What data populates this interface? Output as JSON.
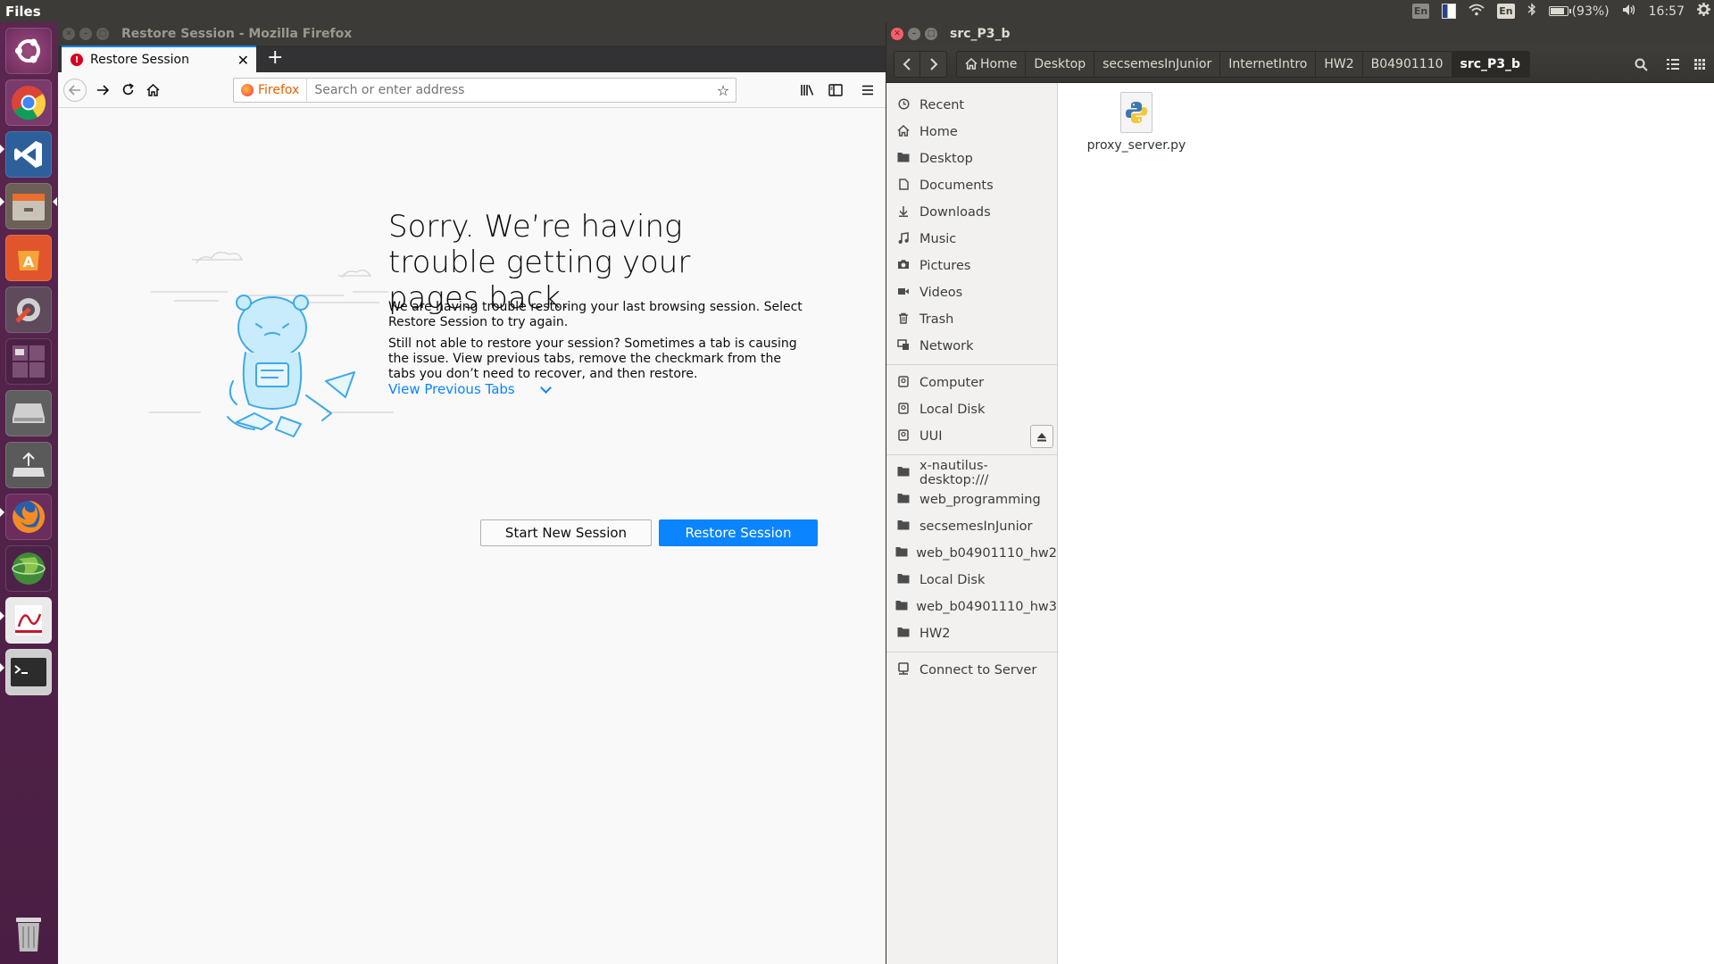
{
  "top_panel": {
    "app_name": "Files",
    "keyboard_indicator_1": "En",
    "keyboard_indicator_2": "En",
    "battery_percent_text": "(93%)",
    "battery_level": 0.93,
    "clock": "16:57"
  },
  "firefox": {
    "window_title": "Restore Session - Mozilla Firefox",
    "tab_title": "Restore Session",
    "identity_label": "Firefox",
    "url_placeholder": "Search or enter address",
    "error_title": "Sorry. We’re having trouble getting your pages back.",
    "paragraph_1": "We are having trouble restoring your last browsing session. Select Restore Session to try again.",
    "paragraph_2": "Still not able to restore your session? Sometimes a tab is causing the issue. View previous tabs, remove the checkmark from the tabs you don’t need to recover, and then restore.",
    "view_previous_tabs": "View Previous Tabs",
    "start_new_session": "Start New Session",
    "restore_session": "Restore Session"
  },
  "nautilus": {
    "window_title": "src_P3_b",
    "breadcrumbs": [
      "Home",
      "Desktop",
      "secsemesInJunior",
      "InternetIntro",
      "HW2",
      "B04901110",
      "src_P3_b"
    ],
    "places": [
      {
        "label": "Recent",
        "icon": "clock-icon"
      },
      {
        "label": "Home",
        "icon": "home-icon"
      },
      {
        "label": "Desktop",
        "icon": "folder-icon"
      },
      {
        "label": "Documents",
        "icon": "document-icon"
      },
      {
        "label": "Downloads",
        "icon": "download-icon"
      },
      {
        "label": "Music",
        "icon": "music-icon"
      },
      {
        "label": "Pictures",
        "icon": "camera-icon"
      },
      {
        "label": "Videos",
        "icon": "video-icon"
      },
      {
        "label": "Trash",
        "icon": "trash-icon"
      },
      {
        "label": "Network",
        "icon": "network-icon"
      }
    ],
    "devices": [
      {
        "label": "Computer"
      },
      {
        "label": "Local Disk"
      },
      {
        "label": "UUI"
      }
    ],
    "bookmarks": [
      {
        "label": "x-nautilus-desktop:///"
      },
      {
        "label": "web_programming"
      },
      {
        "label": "secsemesInJunior"
      },
      {
        "label": "web_b04901110_hw2"
      },
      {
        "label": "Local Disk"
      },
      {
        "label": "web_b04901110_hw3"
      },
      {
        "label": "HW2"
      }
    ],
    "connect_to_server": "Connect to Server",
    "files": [
      {
        "name": "proxy_server.py",
        "icon": "python-file-icon"
      }
    ]
  },
  "launcher": [
    "ubuntu-logo-icon",
    "chrome-icon",
    "vscode-icon",
    "files-icon",
    "software-center-icon",
    "system-settings-icon",
    "workspace-switcher-icon",
    "disk-icon",
    "usb-drive-icon",
    "firefox-icon",
    "network-globe-icon",
    "pdf-viewer-icon",
    "terminal-icon",
    "trash-icon"
  ]
}
